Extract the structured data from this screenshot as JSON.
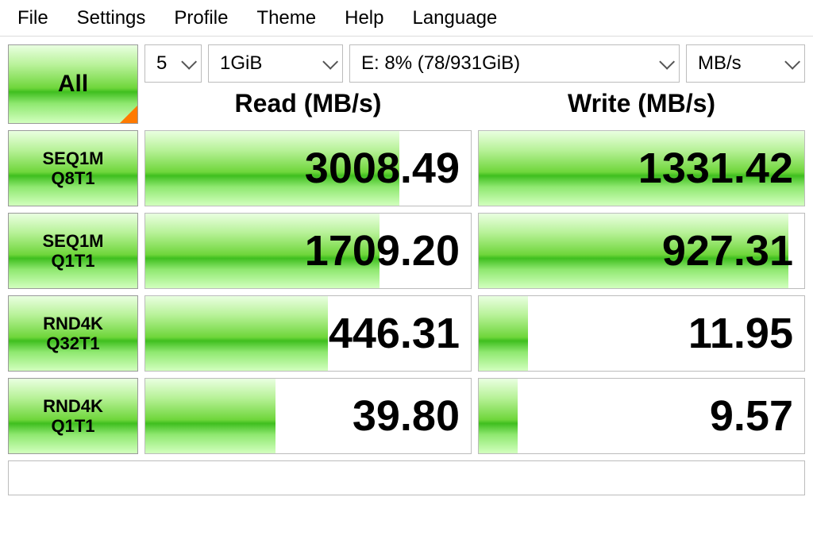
{
  "menu": [
    "File",
    "Settings",
    "Profile",
    "Theme",
    "Help",
    "Language"
  ],
  "controls": {
    "all_label": "All",
    "loops": "5",
    "size": "1GiB",
    "drive": "E: 8% (78/931GiB)",
    "unit": "MB/s"
  },
  "headers": {
    "read": "Read (MB/s)",
    "write": "Write (MB/s)"
  },
  "rows": [
    {
      "label1": "SEQ1M",
      "label2": "Q8T1",
      "read": "3008.49",
      "write": "1331.42",
      "read_fill": 78,
      "write_fill": 100
    },
    {
      "label1": "SEQ1M",
      "label2": "Q1T1",
      "read": "1709.20",
      "write": "927.31",
      "read_fill": 72,
      "write_fill": 95
    },
    {
      "label1": "RND4K",
      "label2": "Q32T1",
      "read": "446.31",
      "write": "11.95",
      "read_fill": 56,
      "write_fill": 15
    },
    {
      "label1": "RND4K",
      "label2": "Q1T1",
      "read": "39.80",
      "write": "9.57",
      "read_fill": 40,
      "write_fill": 12
    }
  ],
  "chart_data": {
    "type": "bar",
    "title": "Disk Benchmark",
    "unit": "MB/s",
    "categories": [
      "SEQ1M Q8T1",
      "SEQ1M Q1T1",
      "RND4K Q32T1",
      "RND4K Q1T1"
    ],
    "series": [
      {
        "name": "Read (MB/s)",
        "values": [
          3008.49,
          1709.2,
          446.31,
          39.8
        ]
      },
      {
        "name": "Write (MB/s)",
        "values": [
          1331.42,
          927.31,
          11.95,
          9.57
        ]
      }
    ]
  }
}
